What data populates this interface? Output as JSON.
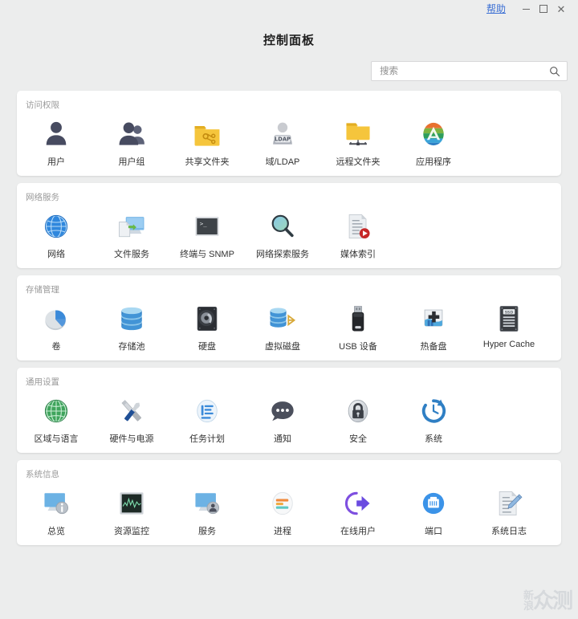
{
  "window": {
    "help_label": "帮助",
    "minimize_label": "–",
    "maximize_label": "□",
    "close_label": "✕"
  },
  "header": {
    "title": "控制面板"
  },
  "search": {
    "placeholder": "搜索",
    "value": "",
    "icon": "search-icon"
  },
  "watermark": {
    "line1": "新",
    "line2": "浪",
    "main": "众测"
  },
  "sections": [
    {
      "id": "access-permissions",
      "title": "访问权限",
      "items": [
        {
          "label": "用户",
          "icon": "user-icon"
        },
        {
          "label": "用户组",
          "icon": "user-group-icon"
        },
        {
          "label": "共享文件夹",
          "icon": "shared-folder-icon"
        },
        {
          "label": "域/LDAP",
          "icon": "ldap-domain-icon"
        },
        {
          "label": "远程文件夹",
          "icon": "remote-folder-icon"
        },
        {
          "label": "应用程序",
          "icon": "application-icon"
        }
      ]
    },
    {
      "id": "network-services",
      "title": "网络服务",
      "items": [
        {
          "label": "网络",
          "icon": "globe-network-icon"
        },
        {
          "label": "文件服务",
          "icon": "file-service-icon"
        },
        {
          "label": "终端与 SNMP",
          "icon": "terminal-snmp-icon"
        },
        {
          "label": "网络探索服务",
          "icon": "network-discovery-icon"
        },
        {
          "label": "媒体索引",
          "icon": "media-index-icon"
        }
      ]
    },
    {
      "id": "storage-management",
      "title": "存储管理",
      "items": [
        {
          "label": "卷",
          "icon": "volume-pie-icon"
        },
        {
          "label": "存储池",
          "icon": "storage-pool-icon"
        },
        {
          "label": "硬盘",
          "icon": "hard-disk-icon"
        },
        {
          "label": "虚拟磁盘",
          "icon": "virtual-disk-icon"
        },
        {
          "label": "USB 设备",
          "icon": "usb-device-icon"
        },
        {
          "label": "热备盘",
          "icon": "hot-spare-icon"
        },
        {
          "label": "Hyper Cache",
          "icon": "ssd-cache-icon"
        }
      ]
    },
    {
      "id": "general-settings",
      "title": "通用设置",
      "items": [
        {
          "label": "区域与语言",
          "icon": "region-language-icon"
        },
        {
          "label": "硬件与电源",
          "icon": "hardware-power-icon"
        },
        {
          "label": "任务计划",
          "icon": "task-schedule-icon"
        },
        {
          "label": "通知",
          "icon": "notification-icon"
        },
        {
          "label": "安全",
          "icon": "security-lock-icon"
        },
        {
          "label": "系统",
          "icon": "system-clock-icon"
        }
      ]
    },
    {
      "id": "system-information",
      "title": "系统信息",
      "items": [
        {
          "label": "总览",
          "icon": "overview-icon"
        },
        {
          "label": "资源监控",
          "icon": "resource-monitor-icon"
        },
        {
          "label": "服务",
          "icon": "service-icon"
        },
        {
          "label": "进程",
          "icon": "process-icon"
        },
        {
          "label": "在线用户",
          "icon": "online-user-icon"
        },
        {
          "label": "端口",
          "icon": "port-icon"
        },
        {
          "label": "系统日志",
          "icon": "system-log-icon"
        }
      ]
    }
  ],
  "colors": {
    "accent_link": "#3b6fd4",
    "folder_yellow": "#f2c13c",
    "user_slate": "#4b4f63",
    "card_bg": "#ffffff",
    "page_bg": "#eceded"
  }
}
